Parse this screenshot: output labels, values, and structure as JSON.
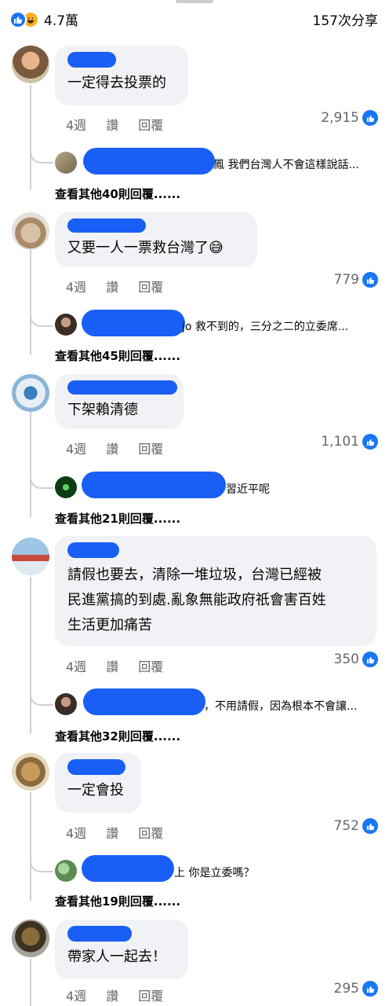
{
  "header": {
    "reaction_count": "4.7萬",
    "share_count": "157次分享",
    "reaction_icons": [
      "like-icon",
      "haha-icon"
    ]
  },
  "action_labels": {
    "time": "4週",
    "like": "讚",
    "reply": "回覆"
  },
  "comments": [
    {
      "text": "一定得去投票的",
      "time": "4週",
      "likes": "2,915",
      "reply_preview": "鳳 我們台灣人不會這樣說話...",
      "more_replies": "查看其他40則回覆......"
    },
    {
      "text": "又要一人一票救台灣了😅",
      "time": "4週",
      "likes": "779",
      "reply_preview": "jo 救不到的，三分之二的立委席...",
      "more_replies": "查看其他45則回覆......"
    },
    {
      "text": "下架賴清德",
      "time": "4週",
      "likes": "1,101",
      "reply_preview": "習近平呢",
      "more_replies": "查看其他21則回覆......"
    },
    {
      "text": "請假也要去，清除一堆垃圾，台灣已經被\n民進黨搞的到處.亂象無能政府祇會害百姓\n生活更加痛苦",
      "time": "4週",
      "likes": "350",
      "reply_preview": "，不用請假，因為根本不會讓...",
      "more_replies": "查看其他32則回覆......"
    },
    {
      "text": "一定會投",
      "time": "4週",
      "likes": "752",
      "reply_preview": "上 你是立委嗎？",
      "more_replies": "查看其他19則回覆......"
    },
    {
      "text": "帶家人一起去！",
      "time": "4週",
      "likes": "295"
    }
  ],
  "colors": {
    "like_blue": "#1877f2",
    "bubble_bg": "#f0f2f5",
    "meta_gray": "#65676b",
    "redaction": "#1a5ff5"
  }
}
